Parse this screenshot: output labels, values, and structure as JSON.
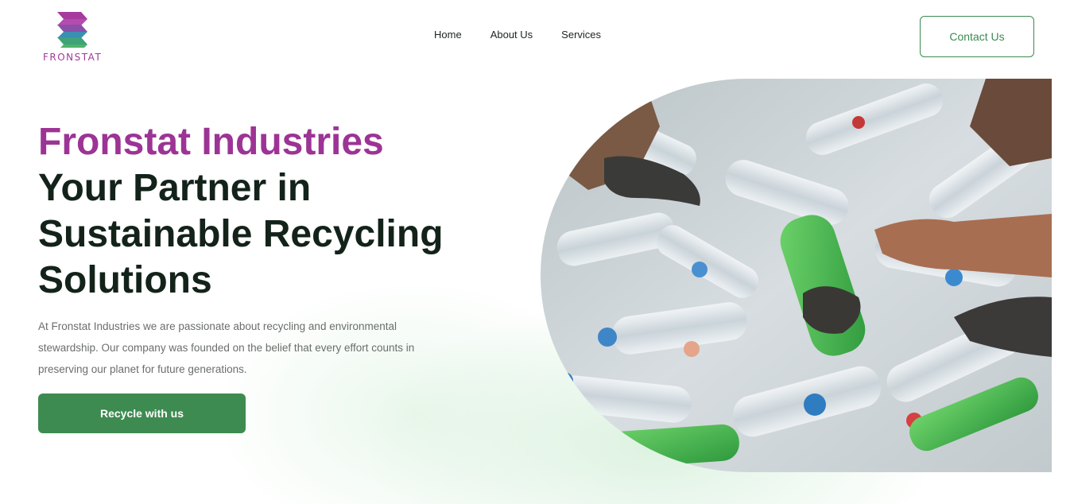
{
  "brand": {
    "logo_text": "FRONSTAT",
    "purple": "#9c3495",
    "green": "#3d8b50",
    "teal": "#2f8fa0"
  },
  "nav": {
    "items": [
      "Home",
      "About Us",
      "Services"
    ]
  },
  "header": {
    "contact_label": "Contact Us"
  },
  "hero": {
    "title": "Fronstat Industries",
    "tagline": "Your Partner in Sustainable Recycling Solutions",
    "description": "At Fronstat Industries we are passionate about recycling and environmental stewardship. Our company was founded on the belief that every effort counts in preserving our planet for future generations.",
    "cta_label": "Recycle with us",
    "image_subject": "hands-sorting-plastic-bottles"
  }
}
